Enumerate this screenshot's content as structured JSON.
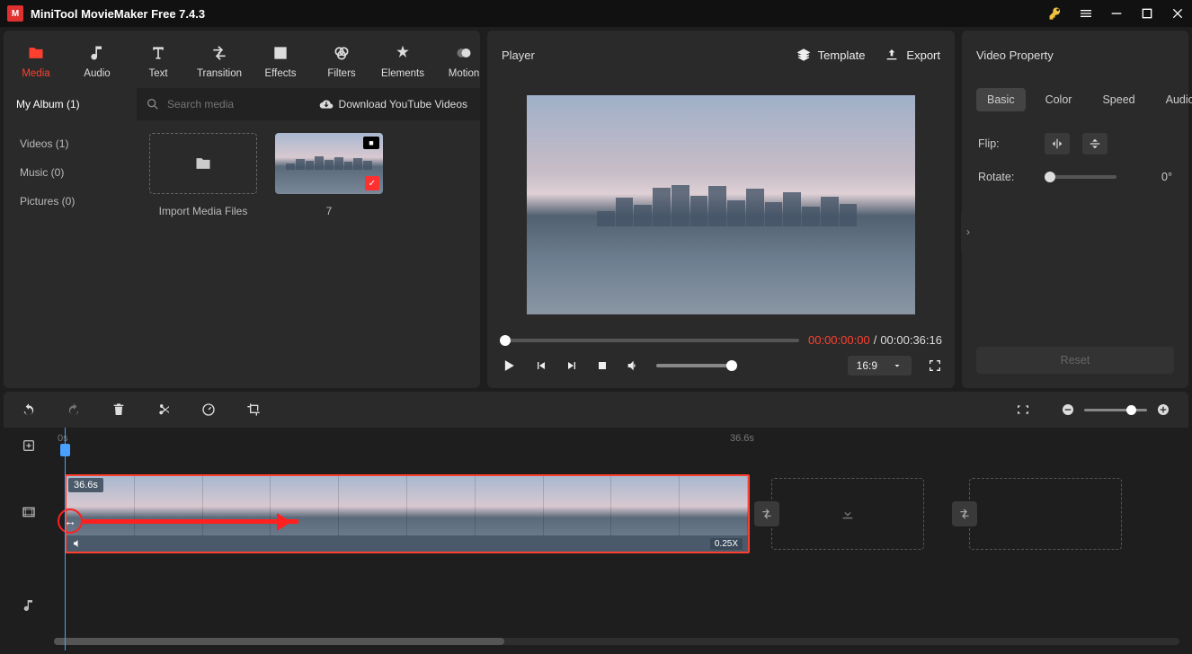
{
  "app": {
    "title": "MiniTool MovieMaker Free 7.4.3"
  },
  "toolbar": {
    "media": "Media",
    "audio": "Audio",
    "text": "Text",
    "transition": "Transition",
    "effects": "Effects",
    "filters": "Filters",
    "elements": "Elements",
    "motion": "Motion"
  },
  "library": {
    "tab": "My Album (1)",
    "search_placeholder": "Search media",
    "download_yt": "Download YouTube Videos",
    "side": {
      "videos": "Videos (1)",
      "music": "Music (0)",
      "pictures": "Pictures (0)"
    },
    "import_label": "Import Media Files",
    "clip_label": "7"
  },
  "player": {
    "title": "Player",
    "template": "Template",
    "export": "Export",
    "cur_time": "00:00:00:00",
    "sep": " / ",
    "total_time": "00:00:36:16",
    "aspect": "16:9"
  },
  "props": {
    "title": "Video Property",
    "tabs": {
      "basic": "Basic",
      "color": "Color",
      "speed": "Speed",
      "audio": "Audio"
    },
    "flip": "Flip:",
    "rotate": "Rotate:",
    "rotate_val": "0°",
    "reset": "Reset"
  },
  "ruler": {
    "start": "0s",
    "mid": "36.6s"
  },
  "clip": {
    "duration": "36.6s",
    "speed": "0.25X"
  }
}
